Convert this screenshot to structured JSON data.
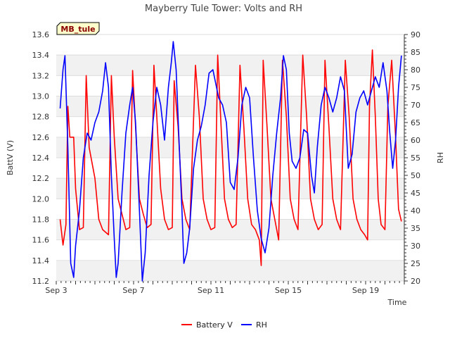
{
  "chart_data": {
    "type": "line",
    "title": "Mayberry Tule Tower: Volts and RH",
    "badge": "MB_tule",
    "xlabel": "Time",
    "ylabel_left": "BattV (V)",
    "ylabel_right": "RH",
    "x_ticks": [
      {
        "day": 3,
        "label": "Sep 3"
      },
      {
        "day": 7,
        "label": "Sep 7"
      },
      {
        "day": 11,
        "label": "Sep 11"
      },
      {
        "day": 15,
        "label": "Sep 15"
      },
      {
        "day": 19,
        "label": "Sep 19"
      }
    ],
    "x_range_days": [
      3.0,
      21.0
    ],
    "y_left_range": [
      11.2,
      13.6
    ],
    "y_left_ticks": [
      "11.2",
      "11.4",
      "11.6",
      "11.8",
      "12.0",
      "12.2",
      "12.4",
      "12.6",
      "12.8",
      "13.0",
      "13.2",
      "13.4",
      "13.6"
    ],
    "y_right_range": [
      20,
      90
    ],
    "y_right_ticks": [
      "20",
      "25",
      "30",
      "35",
      "40",
      "45",
      "50",
      "55",
      "60",
      "65",
      "70",
      "75",
      "80",
      "85",
      "90"
    ],
    "grid": true,
    "legend_position": "bottom-center",
    "series": [
      {
        "name": "Battery V",
        "color": "#ff0000",
        "axis": "left",
        "points": [
          [
            3.2,
            11.8
          ],
          [
            3.35,
            11.55
          ],
          [
            3.5,
            11.75
          ],
          [
            3.6,
            12.9
          ],
          [
            3.7,
            12.6
          ],
          [
            3.9,
            12.6
          ],
          [
            4.0,
            12.1
          ],
          [
            4.2,
            11.7
          ],
          [
            4.4,
            11.72
          ],
          [
            4.55,
            13.2
          ],
          [
            4.7,
            12.5
          ],
          [
            5.0,
            12.2
          ],
          [
            5.2,
            11.8
          ],
          [
            5.4,
            11.7
          ],
          [
            5.7,
            11.65
          ],
          [
            5.85,
            13.2
          ],
          [
            6.0,
            12.6
          ],
          [
            6.2,
            12.0
          ],
          [
            6.4,
            11.85
          ],
          [
            6.6,
            11.7
          ],
          [
            6.8,
            11.72
          ],
          [
            6.95,
            13.25
          ],
          [
            7.1,
            12.7
          ],
          [
            7.3,
            12.0
          ],
          [
            7.5,
            11.85
          ],
          [
            7.7,
            11.72
          ],
          [
            7.9,
            11.75
          ],
          [
            8.05,
            13.3
          ],
          [
            8.2,
            12.8
          ],
          [
            8.4,
            12.1
          ],
          [
            8.6,
            11.8
          ],
          [
            8.8,
            11.7
          ],
          [
            9.0,
            11.72
          ],
          [
            9.1,
            13.15
          ],
          [
            9.3,
            12.7
          ],
          [
            9.5,
            12.0
          ],
          [
            9.7,
            11.8
          ],
          [
            9.9,
            11.7
          ],
          [
            10.2,
            13.3
          ],
          [
            10.4,
            12.8
          ],
          [
            10.6,
            12.0
          ],
          [
            10.8,
            11.8
          ],
          [
            11.0,
            11.7
          ],
          [
            11.2,
            11.72
          ],
          [
            11.35,
            13.4
          ],
          [
            11.5,
            12.8
          ],
          [
            11.7,
            12.0
          ],
          [
            11.9,
            11.8
          ],
          [
            12.1,
            11.72
          ],
          [
            12.3,
            11.75
          ],
          [
            12.5,
            13.3
          ],
          [
            12.7,
            12.7
          ],
          [
            12.9,
            12.0
          ],
          [
            13.1,
            11.75
          ],
          [
            13.3,
            11.7
          ],
          [
            13.5,
            11.6
          ],
          [
            13.6,
            11.35
          ],
          [
            13.7,
            13.35
          ],
          [
            13.9,
            12.7
          ],
          [
            14.1,
            12.0
          ],
          [
            14.3,
            11.8
          ],
          [
            14.5,
            11.6
          ],
          [
            14.7,
            13.35
          ],
          [
            14.9,
            12.8
          ],
          [
            15.1,
            12.0
          ],
          [
            15.3,
            11.8
          ],
          [
            15.5,
            11.7
          ],
          [
            15.75,
            13.4
          ],
          [
            15.95,
            12.8
          ],
          [
            16.15,
            12.0
          ],
          [
            16.35,
            11.8
          ],
          [
            16.55,
            11.7
          ],
          [
            16.75,
            11.75
          ],
          [
            16.9,
            13.35
          ],
          [
            17.1,
            12.7
          ],
          [
            17.3,
            12.0
          ],
          [
            17.5,
            11.8
          ],
          [
            17.7,
            11.7
          ],
          [
            17.95,
            13.35
          ],
          [
            18.15,
            12.8
          ],
          [
            18.35,
            12.0
          ],
          [
            18.55,
            11.8
          ],
          [
            18.75,
            11.7
          ],
          [
            18.95,
            11.65
          ],
          [
            19.1,
            11.6
          ],
          [
            19.2,
            12.9
          ],
          [
            19.35,
            13.45
          ],
          [
            19.5,
            12.8
          ],
          [
            19.65,
            12.0
          ],
          [
            19.8,
            11.75
          ],
          [
            20.0,
            11.7
          ],
          [
            20.15,
            12.9
          ],
          [
            20.35,
            13.35
          ],
          [
            20.55,
            12.6
          ],
          [
            20.7,
            11.9
          ],
          [
            20.85,
            11.78
          ]
        ]
      },
      {
        "name": "RH",
        "color": "#0000ff",
        "axis": "right",
        "points": [
          [
            3.2,
            69.0
          ],
          [
            3.35,
            80.0
          ],
          [
            3.45,
            84.0
          ],
          [
            3.6,
            58.0
          ],
          [
            3.75,
            25.0
          ],
          [
            3.9,
            21.0
          ],
          [
            4.0,
            30.0
          ],
          [
            4.2,
            40.0
          ],
          [
            4.4,
            55.0
          ],
          [
            4.6,
            62.0
          ],
          [
            4.8,
            60.0
          ],
          [
            5.0,
            65.0
          ],
          [
            5.2,
            68.0
          ],
          [
            5.4,
            74.0
          ],
          [
            5.55,
            82.0
          ],
          [
            5.7,
            75.0
          ],
          [
            5.85,
            50.0
          ],
          [
            6.0,
            32.0
          ],
          [
            6.1,
            21.0
          ],
          [
            6.2,
            25.0
          ],
          [
            6.4,
            45.0
          ],
          [
            6.6,
            62.0
          ],
          [
            6.8,
            70.0
          ],
          [
            6.95,
            75.0
          ],
          [
            7.1,
            65.0
          ],
          [
            7.3,
            40.0
          ],
          [
            7.45,
            20.0
          ],
          [
            7.6,
            28.0
          ],
          [
            7.8,
            50.0
          ],
          [
            8.0,
            65.0
          ],
          [
            8.2,
            75.0
          ],
          [
            8.4,
            70.0
          ],
          [
            8.6,
            60.0
          ],
          [
            8.8,
            75.0
          ],
          [
            8.95,
            82.0
          ],
          [
            9.05,
            88.0
          ],
          [
            9.2,
            80.0
          ],
          [
            9.35,
            60.0
          ],
          [
            9.5,
            40.0
          ],
          [
            9.6,
            25.0
          ],
          [
            9.75,
            28.0
          ],
          [
            9.9,
            35.0
          ],
          [
            10.1,
            52.0
          ],
          [
            10.3,
            60.0
          ],
          [
            10.5,
            64.0
          ],
          [
            10.7,
            70.0
          ],
          [
            10.9,
            79.0
          ],
          [
            11.1,
            80.0
          ],
          [
            11.25,
            76.0
          ],
          [
            11.4,
            72.0
          ],
          [
            11.6,
            70.0
          ],
          [
            11.8,
            65.0
          ],
          [
            12.0,
            48.0
          ],
          [
            12.2,
            46.0
          ],
          [
            12.4,
            55.0
          ],
          [
            12.6,
            70.0
          ],
          [
            12.8,
            75.0
          ],
          [
            13.0,
            72.0
          ],
          [
            13.2,
            55.0
          ],
          [
            13.4,
            40.0
          ],
          [
            13.6,
            32.0
          ],
          [
            13.8,
            28.0
          ],
          [
            14.0,
            35.0
          ],
          [
            14.2,
            50.0
          ],
          [
            14.4,
            62.0
          ],
          [
            14.6,
            72.0
          ],
          [
            14.75,
            84.0
          ],
          [
            14.9,
            80.0
          ],
          [
            15.05,
            62.0
          ],
          [
            15.2,
            54.0
          ],
          [
            15.4,
            52.0
          ],
          [
            15.6,
            55.0
          ],
          [
            15.8,
            63.0
          ],
          [
            16.0,
            62.0
          ],
          [
            16.2,
            50.0
          ],
          [
            16.35,
            45.0
          ],
          [
            16.5,
            58.0
          ],
          [
            16.7,
            70.0
          ],
          [
            16.9,
            75.0
          ],
          [
            17.1,
            72.0
          ],
          [
            17.3,
            68.0
          ],
          [
            17.5,
            72.0
          ],
          [
            17.7,
            78.0
          ],
          [
            17.9,
            74.0
          ],
          [
            18.1,
            52.0
          ],
          [
            18.3,
            56.0
          ],
          [
            18.5,
            68.0
          ],
          [
            18.7,
            72.0
          ],
          [
            18.9,
            74.0
          ],
          [
            19.1,
            70.0
          ],
          [
            19.3,
            74.0
          ],
          [
            19.5,
            78.0
          ],
          [
            19.7,
            75.0
          ],
          [
            19.9,
            82.0
          ],
          [
            20.1,
            74.0
          ],
          [
            20.25,
            62.0
          ],
          [
            20.4,
            52.0
          ],
          [
            20.55,
            60.0
          ],
          [
            20.7,
            75.0
          ],
          [
            20.85,
            84.0
          ]
        ]
      }
    ]
  }
}
